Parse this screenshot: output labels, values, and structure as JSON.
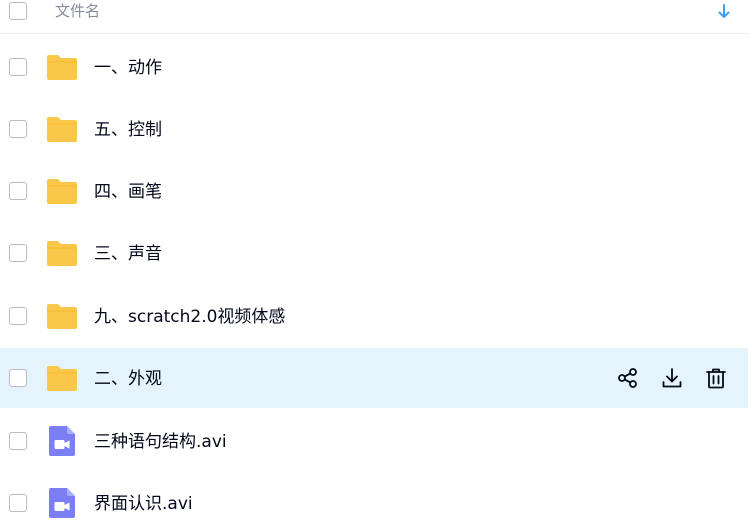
{
  "header": {
    "column_label": "文件名",
    "sort_icon": "arrow-down-icon"
  },
  "files": [
    {
      "name": "一、动作",
      "type": "folder",
      "icon": "folder-icon"
    },
    {
      "name": "五、控制",
      "type": "folder",
      "icon": "folder-icon"
    },
    {
      "name": "四、画笔",
      "type": "folder",
      "icon": "folder-icon"
    },
    {
      "name": "三、声音",
      "type": "folder",
      "icon": "folder-icon"
    },
    {
      "name": "九、scratch2.0视频体感",
      "type": "folder",
      "icon": "folder-icon"
    },
    {
      "name": "二、外观",
      "type": "folder",
      "icon": "folder-icon",
      "hovered": true
    },
    {
      "name": "三种语句结构.avi",
      "type": "video",
      "icon": "video-file-icon"
    },
    {
      "name": "界面认识.avi",
      "type": "video",
      "icon": "video-file-icon"
    }
  ],
  "row_actions": [
    {
      "icon": "share-icon"
    },
    {
      "icon": "download-icon"
    },
    {
      "icon": "trash-icon"
    }
  ],
  "colors": {
    "folder": "#f9c84a",
    "video": "#7b7ff3",
    "hover_row": "#e5f4fc",
    "sort_arrow": "#3f9ff0",
    "text": "#03081a",
    "header_text": "#878c9c"
  }
}
